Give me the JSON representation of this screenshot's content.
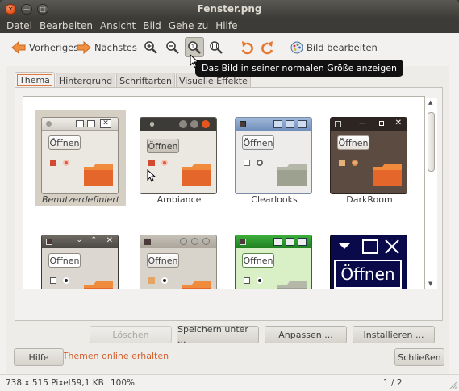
{
  "window": {
    "title": "Fenster.png"
  },
  "menu": [
    "Datei",
    "Bearbeiten",
    "Ansicht",
    "Bild",
    "Gehe zu",
    "Hilfe"
  ],
  "toolbar": {
    "previous_label": "Vorheriges",
    "next_label": "Nächstes",
    "edit_label": "Bild bearbeiten",
    "tooltip": "Das Bild in seiner normalen Größe anzeigen"
  },
  "tabs": [
    "Thema",
    "Hintergrund",
    "Schriftarten",
    "Visuelle Effekte"
  ],
  "themes": [
    {
      "name": "Benutzerdefiniert",
      "button": "Öffnen",
      "selected": true
    },
    {
      "name": "Ambiance",
      "button": "Öffnen",
      "selected": false
    },
    {
      "name": "Clearlooks",
      "button": "Öffnen",
      "selected": false
    },
    {
      "name": "DarkRoom",
      "button": "Öffnen",
      "selected": false
    },
    {
      "name": "",
      "button": "Öffnen",
      "selected": false
    },
    {
      "name": "",
      "button": "Öffnen",
      "selected": false
    },
    {
      "name": "",
      "button": "Öffnen",
      "selected": false
    },
    {
      "name": "",
      "button": "Öffnen",
      "selected": false
    }
  ],
  "buttons": {
    "delete": "Löschen",
    "save_as": "Speichern unter ...",
    "customize": "Anpassen ...",
    "install": "Installieren ..."
  },
  "more_themes_link": "Weitere Themen online erhalten",
  "footer": {
    "help": "Hilfe",
    "close": "Schließen"
  },
  "status": {
    "dimensions": "738 x 515 Pixel",
    "filesize": "59,1 KB",
    "zoom": "100%",
    "page": "1 / 2"
  },
  "colors": {
    "accent": "#e07a3c",
    "titlebar": "#3c3b37",
    "link": "#d35f2e"
  }
}
